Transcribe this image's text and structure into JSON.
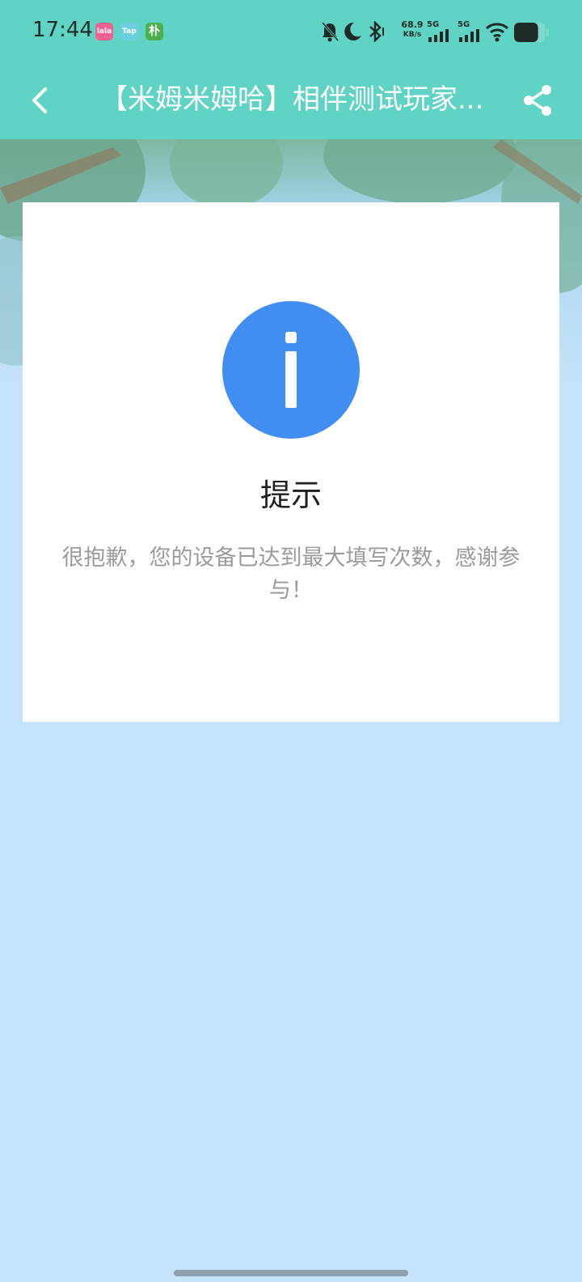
{
  "status_bar": {
    "time": "17:44",
    "app_badges": [
      {
        "label": "lalala",
        "color": "#f06292"
      },
      {
        "label": "Tap",
        "color": "#6ad0e0"
      },
      {
        "label": "朴",
        "color": "#4caf50"
      }
    ],
    "net_speed_value": "68.9",
    "net_speed_unit": "KB/s",
    "sim1_label": "5G",
    "sim2_label": "5G",
    "icons": [
      "mute-icon",
      "moon-icon",
      "bluetooth-icon",
      "signal-icon",
      "signal-icon",
      "wifi-icon",
      "battery-icon"
    ],
    "battery_level": 0.78
  },
  "header": {
    "title": "【米姆米姆哈】相伴测试玩家...",
    "back_icon": "back-icon",
    "share_icon": "share-icon",
    "background": "#5fd4c4"
  },
  "dialog": {
    "icon": "info-icon",
    "icon_color": "#418ef3",
    "title": "提示",
    "message": "很抱歉，您的设备已达到最大填写次数，感谢参与！"
  },
  "page": {
    "background": "#c5e3fa"
  }
}
